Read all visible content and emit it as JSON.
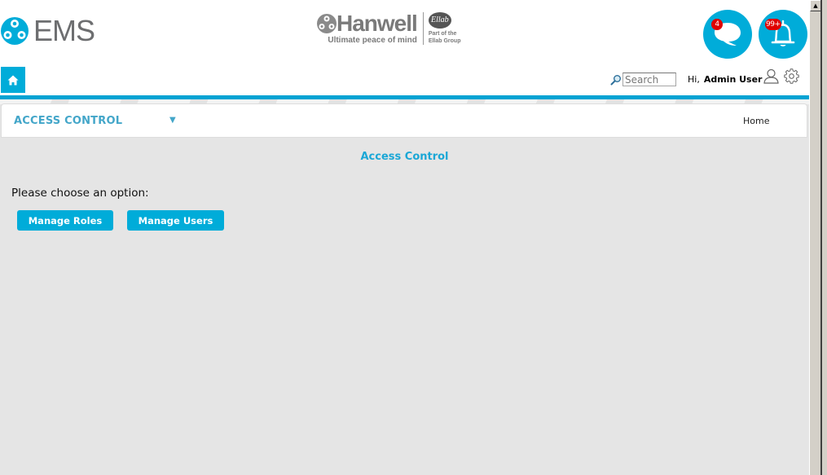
{
  "header": {
    "app_name": "EMS",
    "brand": {
      "name": "Hanwell",
      "tagline": "Ultimate peace of mind",
      "partner_mark": "Ellab",
      "partner_line1": "Part of the",
      "partner_line2": "Ellab Group"
    },
    "messages": {
      "icon": "chat-bubble-icon",
      "badge": "4"
    },
    "notifications": {
      "icon": "bell-icon",
      "badge": "99+"
    },
    "home_icon": "home-icon",
    "search": {
      "placeholder": "Search",
      "value": "",
      "icon": "search-icon"
    },
    "greeting": "Hi,",
    "user_name": "Admin User",
    "user_icon": "user-icon",
    "settings_icon": "gear-icon"
  },
  "section": {
    "title": "ACCESS CONTROL",
    "caret": "▼",
    "breadcrumb": "Home"
  },
  "content": {
    "title": "Access Control",
    "prompt": "Please choose an option:",
    "buttons": [
      {
        "label": "Manage Roles"
      },
      {
        "label": "Manage Users"
      }
    ]
  },
  "scrollbar": {
    "up_arrow": "▲"
  },
  "colors": {
    "accent": "#00acd9",
    "accent_bar": "#00a3d3",
    "section_title": "#43a6c9",
    "badge": "#e00000",
    "background": "#e5e5e5"
  }
}
